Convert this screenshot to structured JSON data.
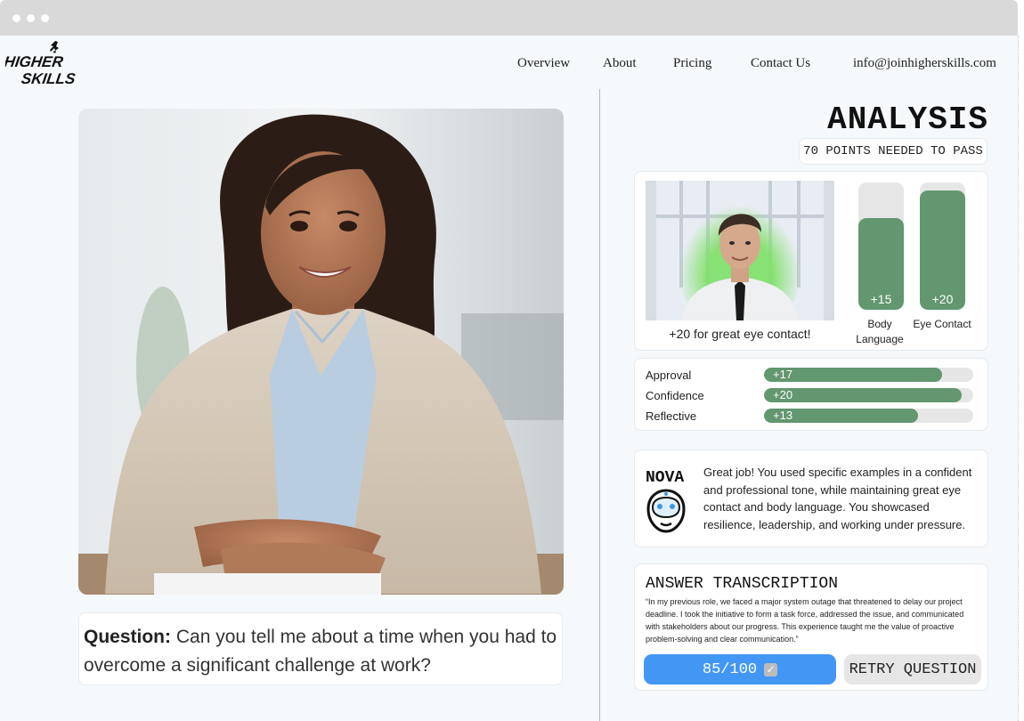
{
  "browser": {
    "dots": 3
  },
  "logo": {
    "line1": "HIGHER",
    "line2": "SKILLS"
  },
  "nav": {
    "overview": "Overview",
    "about": "About",
    "pricing": "Pricing",
    "contact": "Contact Us",
    "email": "info@joinhigherskills.com"
  },
  "question": {
    "label": "Question:",
    "text": "Can you tell me about a time when you had to overcome a significant challenge at work?"
  },
  "analysis": {
    "title": "ANALYSIS",
    "pass_requirement": "70 POINTS NEEDED TO PASS"
  },
  "video_feedback": {
    "caption": "+20 for great eye contact!",
    "bars": [
      {
        "label": "Body Language",
        "value_text": "+15",
        "fill_fraction": 0.72
      },
      {
        "label": "Eye Contact",
        "value_text": "+20",
        "fill_fraction": 0.94
      }
    ]
  },
  "metrics": [
    {
      "label": "Approval",
      "value_text": "+17",
      "fill_fraction": 0.85
    },
    {
      "label": "Confidence",
      "value_text": "+20",
      "fill_fraction": 0.945
    },
    {
      "label": "Reflective",
      "value_text": "+13",
      "fill_fraction": 0.735
    }
  ],
  "nova": {
    "name": "NOVA",
    "message": "Great job! You used specific examples in a confident and professional tone, while maintaining great eye contact and body language. You showcased resilience, leadership, and working under pressure."
  },
  "transcription": {
    "title": "ANSWER TRANSCRIPTION",
    "text": "“In my previous role, we faced a major system outage that threatened to delay our project deadline. I took the initiative to form a task force, addressed the issue, and communicated with stakeholders about our progress. This experience taught me the value of proactive problem-solving and clear communication.”"
  },
  "score": {
    "text": "85/100"
  },
  "retry": {
    "label": "RETRY QUESTION"
  },
  "colors": {
    "accent_green": "#62976f",
    "score_blue": "#4297f5",
    "track_gray": "#e6e6e6",
    "page_bg": "#f5f9fc"
  }
}
